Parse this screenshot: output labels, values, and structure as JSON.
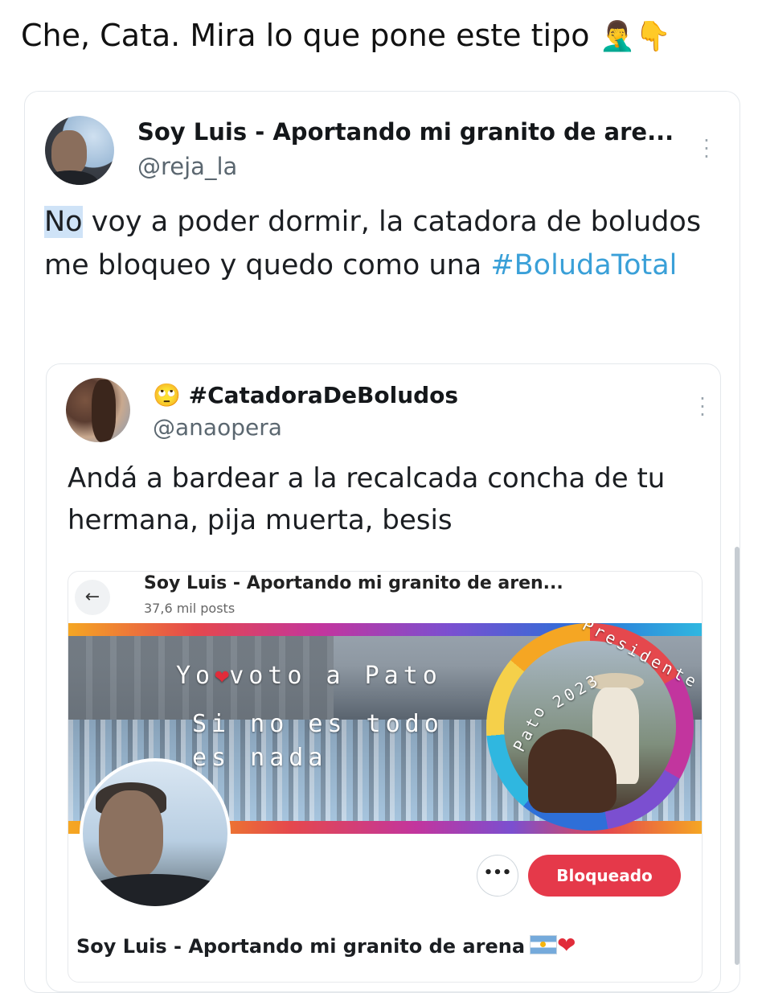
{
  "caption": {
    "text": "Che, Cata. Mira lo que pone este tipo",
    "emojis": [
      "🤦‍♂️",
      "👇"
    ]
  },
  "outer_tweet": {
    "display_name": "Soy Luis - Aportando mi granito de are...",
    "handle": "@reja_la",
    "text_highlighted": "No",
    "text": " voy a poder dormir, la catadora de boludos me bloqueo y quedo como una ",
    "hashtag": "#BoludaTotal",
    "more_icon": "more-vertical-icon"
  },
  "quoted_tweet": {
    "name_emoji": "🙄",
    "display_name": "#CatadoraDeBoludos",
    "handle": "@anaopera",
    "text": "Andá a bardear a la recalcada concha de tu hermana, pija muerta, besis",
    "more_icon": "more-vertical-icon"
  },
  "embedded_profile": {
    "title": "Soy Luis - Aportando mi granito de aren...",
    "posts": "37,6 mil posts",
    "back_icon": "arrow-left-icon",
    "back_glyph": "←",
    "banner": {
      "line1_left": "Yo",
      "line1_right": "voto a Pato",
      "line2": "Si no es todo",
      "line3": "es nada",
      "ring_arc": "Presidente",
      "ring_side": "Pato",
      "ring_year": "2023"
    },
    "more_button": "•••",
    "blocked_button": "Bloqueado",
    "profile_name": "Soy Luis - Aportando mi granito de arena"
  },
  "colors": {
    "hashtag": "#3aa0d8",
    "blocked_button": "#e5394a",
    "text": "#1b1e22",
    "muted": "#5b6770"
  }
}
